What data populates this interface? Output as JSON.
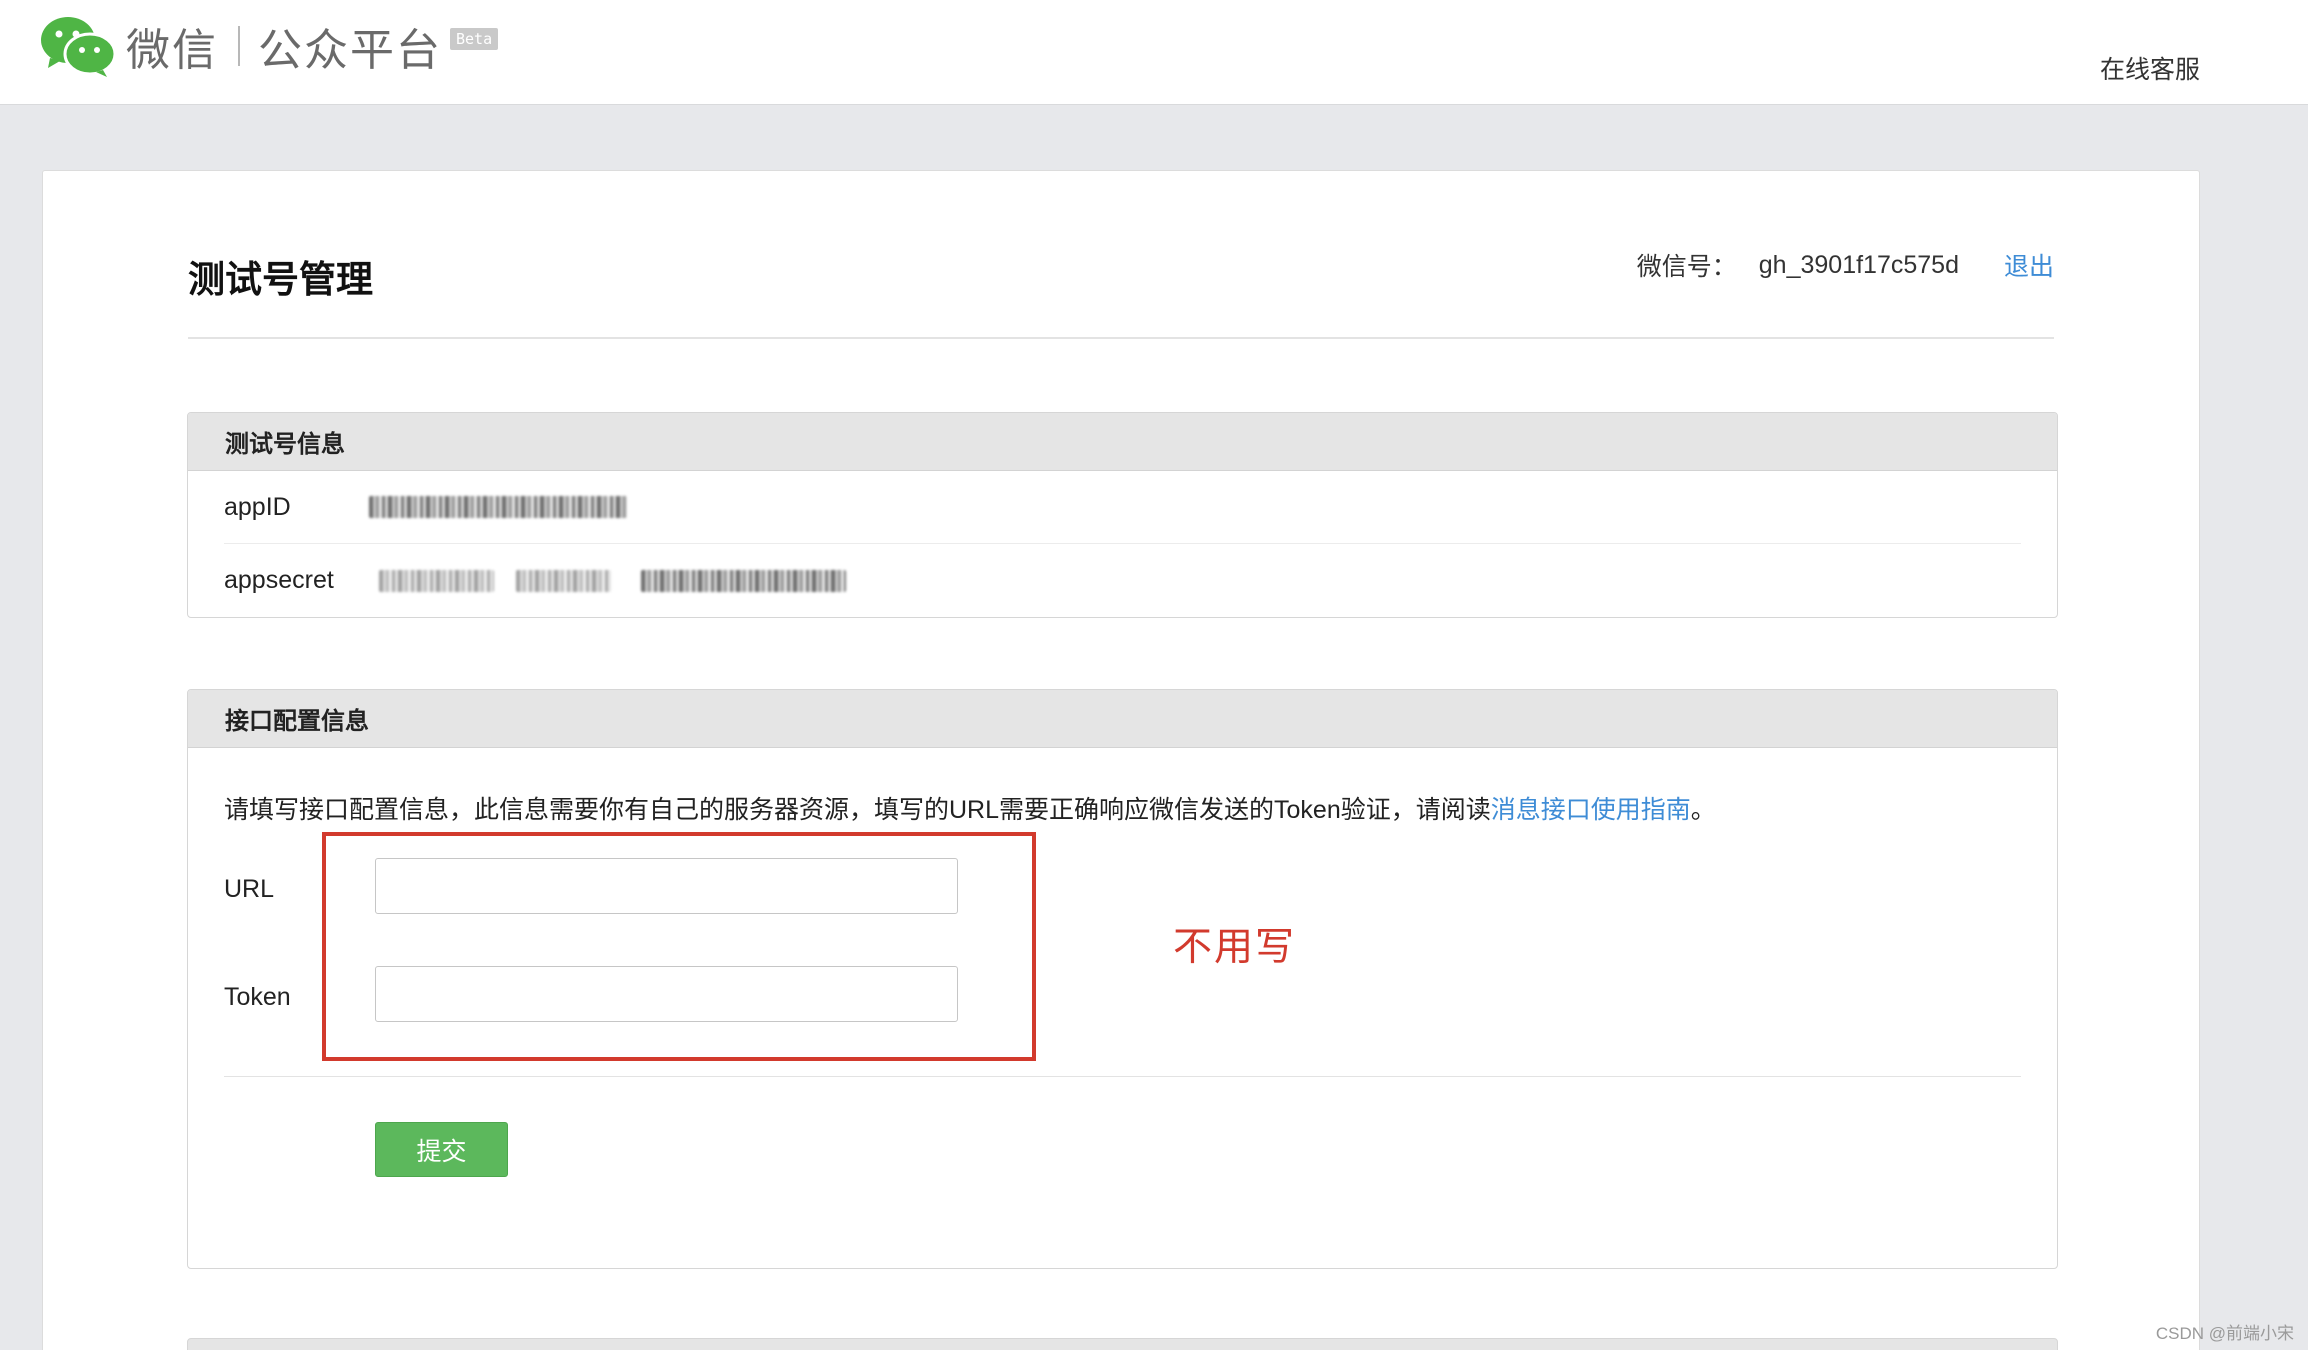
{
  "header": {
    "logo_wechat": "微信",
    "logo_platform": "公众平台",
    "logo_badge": "Beta",
    "service_link": "在线客服"
  },
  "page": {
    "title": "测试号管理",
    "account_label": "微信号：",
    "account_value": "gh_3901f17c575d",
    "logout": "退出"
  },
  "test_info": {
    "heading": "测试号信息",
    "rows": [
      {
        "key": "appID",
        "value_hidden": true
      },
      {
        "key": "appsecret",
        "value_hidden": true
      }
    ]
  },
  "interface_config": {
    "heading": "接口配置信息",
    "description": "请填写接口配置信息，此信息需要你有自己的服务器资源，填写的URL需要正确响应微信发送的Token验证，请阅读",
    "guide_link": "消息接口使用指南",
    "description_end": "。",
    "fields": [
      {
        "label": "URL",
        "value": ""
      },
      {
        "label": "Token",
        "value": ""
      }
    ],
    "annotation": "不用写",
    "submit": "提交"
  },
  "colors": {
    "wechat_green": "#4fb545",
    "link_blue": "#3e8cd6",
    "annotation_red": "#d23a2d",
    "button_green": "#5cb85c"
  },
  "watermark": "CSDN @前端小宋"
}
